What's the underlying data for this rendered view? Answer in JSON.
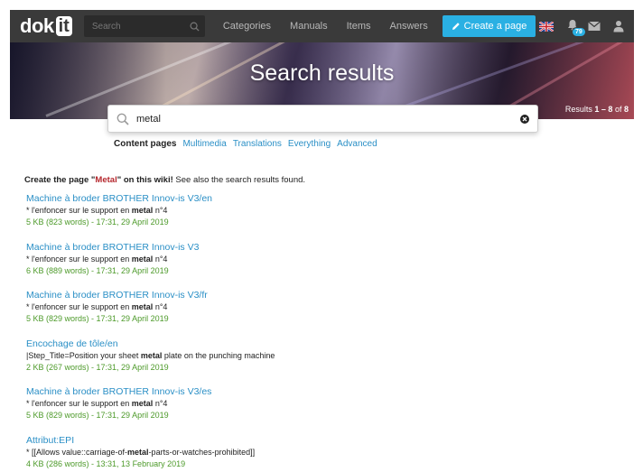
{
  "header": {
    "logo_text": "dok",
    "logo_box": "it",
    "search_placeholder": "Search",
    "nav": [
      "Categories",
      "Manuals",
      "Items",
      "Answers"
    ],
    "create_label": "Create a page",
    "notification_count": "79",
    "colors": {
      "navbar": "#3a3a3a",
      "accent": "#2ab0e3"
    }
  },
  "hero": {
    "title": "Search results",
    "results_prefix": "Results",
    "results_range": "1 – 8",
    "results_of": "of",
    "results_total": "8"
  },
  "search": {
    "value": "metal",
    "icon": "search-icon",
    "clear_icon": "clear-icon"
  },
  "filters": [
    {
      "label": "Content pages",
      "active": true
    },
    {
      "label": "Multimedia",
      "active": false
    },
    {
      "label": "Translations",
      "active": false
    },
    {
      "label": "Everything",
      "active": false
    },
    {
      "label": "Advanced",
      "active": false
    }
  ],
  "create_note": {
    "prefix": "Create the page \"",
    "term": "Metal",
    "suffix": "\" on this wiki!",
    "tail": " See also the search results found."
  },
  "results": [
    {
      "title": "Machine à broder BROTHER Innov-is V3/en",
      "pre": "* l'enfoncer sur le support en ",
      "match": "metal",
      "post": " n°4",
      "meta": "5 KB (823 words) - 17:31, 29 April 2019"
    },
    {
      "title": "Machine à broder BROTHER Innov-is V3",
      "pre": "* l'enfoncer sur le support en ",
      "match": "metal",
      "post": " n°4",
      "meta": "6 KB (889 words) - 17:31, 29 April 2019"
    },
    {
      "title": "Machine à broder BROTHER Innov-is V3/fr",
      "pre": "* l'enfoncer sur le support en ",
      "match": "metal",
      "post": " n°4",
      "meta": "5 KB (829 words) - 17:31, 29 April 2019"
    },
    {
      "title": "Encochage de tôle/en",
      "pre": "|Step_Title=Position your sheet ",
      "match": "metal",
      "post": " plate on the punching machine",
      "meta": "2 KB (267 words) - 17:31, 29 April 2019"
    },
    {
      "title": "Machine à broder BROTHER Innov-is V3/es",
      "pre": "* l'enfoncer sur le support en ",
      "match": "metal",
      "post": " n°4",
      "meta": "5 KB (829 words) - 17:31, 29 April 2019"
    },
    {
      "title": "Attribut:EPI",
      "pre": "* [[Allows value::carriage-of-",
      "match": "metal",
      "post": "-parts-or-watches-prohibited]]",
      "meta": "4 KB (286 words) - 13:31, 13 February 2019"
    }
  ]
}
